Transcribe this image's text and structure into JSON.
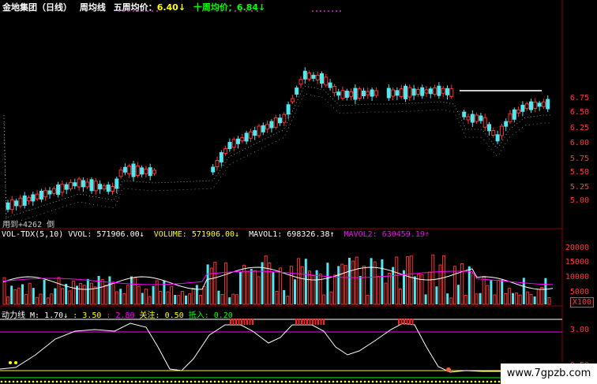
{
  "header": {
    "stock_name": "金地集团（日线）",
    "indicator": "周均线",
    "ma5_label": "五周均价：",
    "ma5_value": "6.40↓",
    "ma10_label": "十周均价：",
    "ma10_value": "6.84↓"
  },
  "price_axis": [
    "6.75",
    "6.50",
    "6.25",
    "6.00",
    "5.75",
    "5.50",
    "5.25",
    "5.00"
  ],
  "price_note": "用到+4262 倒",
  "vol_header": {
    "name": "VOL-TDX(5,10)",
    "vvol": "VVOL: 571906.00↓",
    "volume": "VOLUME: 571906.00↓",
    "mavol1": "MAVOL1: 698326.38↑",
    "mavol2": "MAVOL2: 630459.19↑"
  },
  "vol_axis": [
    "20000",
    "15000",
    "10000",
    "5000"
  ],
  "vol_unit": "X100",
  "osc_header": {
    "name": "动力线",
    "m": "M: 1.70↓",
    "a": ": 3.50",
    "b": ": 2.80",
    "focus": "关注: 0.50",
    "enter": "抵入: 0.20"
  },
  "osc_axis": [
    "3.00",
    "0.50"
  ],
  "watermark": "www.7gpzb.com",
  "colors": {
    "up": "#ff3232",
    "down": "#4fe8f0",
    "header_yellow": "#ffff00",
    "header_green": "#00ff00",
    "mavol2": "#ff00ff"
  }
}
